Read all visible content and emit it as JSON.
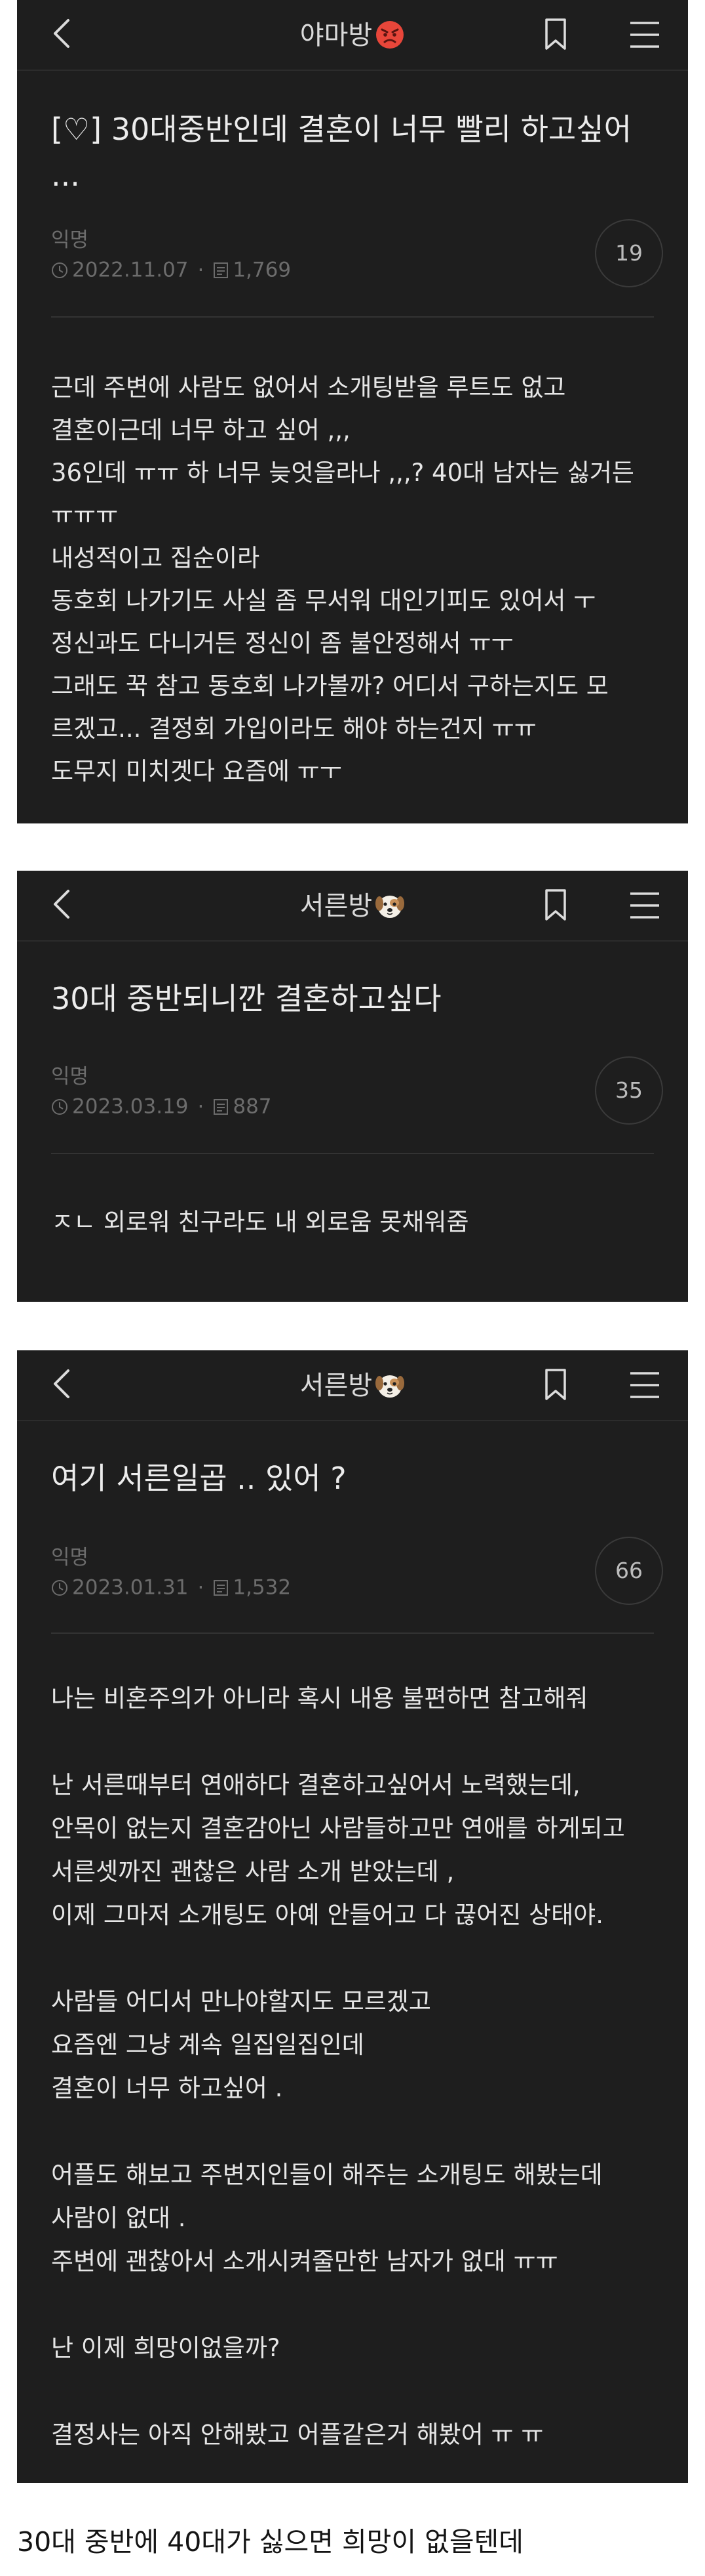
{
  "posts": [
    {
      "board": "야마방",
      "title_lines": [
        "[♡] 30대중반인데 결혼이 너무 빨리 하고싶어",
        "..."
      ],
      "author": "익명",
      "date": "2022.11.07",
      "views": "1,769",
      "comments": "19",
      "body": [
        "근데 주변에 사람도 없어서 소개팅받을 루트도 없고",
        "결혼이근데 너무 하고 싶어 ,,,",
        "36인데 ㅠㅠ 하 너무 늦엇을라나 ,,,? 40대 남자는 싫거든",
        "ㅠㅠㅠ",
        "내성적이고 집순이라",
        "동호회 나가기도 사실 좀 무서워 대인기피도 있어서 ㅜ",
        "정신과도 다니거든 정신이 좀 불안정해서 ㅠㅜ",
        "그래도 꾹 참고 동호회 나가볼까? 어디서 구하는지도 모",
        "르겠고... 결정회 가입이라도 해야 하는건지 ㅠㅠ",
        "도무지 미치겟다 요즘에 ㅠㅜ"
      ]
    },
    {
      "board": "서른방",
      "title_lines": [
        "30대 중반되니깐 결혼하고싶다"
      ],
      "author": "익명",
      "date": "2023.03.19",
      "views": "887",
      "comments": "35",
      "body": [
        "ㅈㄴ 외로워 친구라도 내 외로움 못채워줌"
      ]
    },
    {
      "board": "서른방",
      "title_lines": [
        "여기 서른일곱 .. 있어 ?"
      ],
      "author": "익명",
      "date": "2023.01.31",
      "views": "1,532",
      "comments": "66",
      "body": [
        "나는 비혼주의가 아니라 혹시 내용 불편하면 참고해줘",
        "",
        "난 서른때부터 연애하다 결혼하고싶어서 노력했는데,",
        "안목이 없는지 결혼감아닌 사람들하고만 연애를 하게되고",
        "서른셋까진 괜찮은 사람 소개 받았는데 ,",
        "이제 그마저 소개팅도 아예 안들어고 다 끊어진 상태야.",
        "",
        "사람들 어디서 만나야할지도 모르겠고",
        "요즘엔 그냥 계속 일집일집인데",
        "결혼이 너무 하고싶어 .",
        "",
        "어플도 해보고 주변지인들이 해주는 소개팅도 해봤는데",
        "사람이 없대 .",
        "주변에 괜찮아서 소개시켜줄만한 남자가 없대 ㅠㅠ",
        "",
        "난 이제 희망이없을까?",
        "",
        "결정사는 아직 안해봤고 어플같은거 해봤어 ㅠ ㅠ"
      ]
    }
  ],
  "footer_comment": "30대 중반에 40대가 싫으면 희망이 없을텐데",
  "icons": {
    "back": "chevron-left-icon",
    "bookmark": "bookmark-icon",
    "menu": "hamburger-menu-icon",
    "clock": "clock-icon",
    "views": "views-icon"
  },
  "colors": {
    "panel_bg": "#1e1e1e",
    "text": "#e6e6e6",
    "muted": "#6c6c6c",
    "divider": "#333333"
  }
}
